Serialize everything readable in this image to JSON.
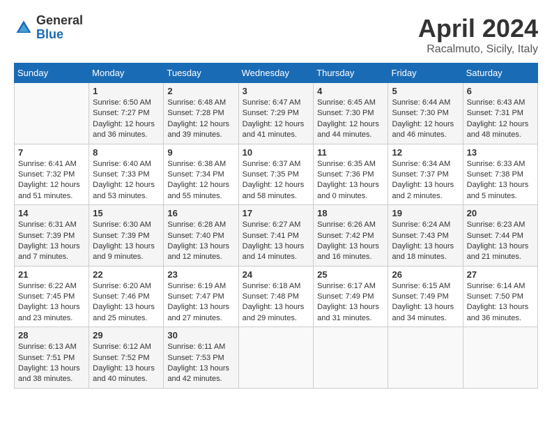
{
  "header": {
    "logo_general": "General",
    "logo_blue": "Blue",
    "title": "April 2024",
    "location": "Racalmuto, Sicily, Italy"
  },
  "days_of_week": [
    "Sunday",
    "Monday",
    "Tuesday",
    "Wednesday",
    "Thursday",
    "Friday",
    "Saturday"
  ],
  "weeks": [
    [
      {
        "day": "",
        "sunrise": "",
        "sunset": "",
        "daylight": ""
      },
      {
        "day": "1",
        "sunrise": "Sunrise: 6:50 AM",
        "sunset": "Sunset: 7:27 PM",
        "daylight": "Daylight: 12 hours and 36 minutes."
      },
      {
        "day": "2",
        "sunrise": "Sunrise: 6:48 AM",
        "sunset": "Sunset: 7:28 PM",
        "daylight": "Daylight: 12 hours and 39 minutes."
      },
      {
        "day": "3",
        "sunrise": "Sunrise: 6:47 AM",
        "sunset": "Sunset: 7:29 PM",
        "daylight": "Daylight: 12 hours and 41 minutes."
      },
      {
        "day": "4",
        "sunrise": "Sunrise: 6:45 AM",
        "sunset": "Sunset: 7:30 PM",
        "daylight": "Daylight: 12 hours and 44 minutes."
      },
      {
        "day": "5",
        "sunrise": "Sunrise: 6:44 AM",
        "sunset": "Sunset: 7:30 PM",
        "daylight": "Daylight: 12 hours and 46 minutes."
      },
      {
        "day": "6",
        "sunrise": "Sunrise: 6:43 AM",
        "sunset": "Sunset: 7:31 PM",
        "daylight": "Daylight: 12 hours and 48 minutes."
      }
    ],
    [
      {
        "day": "7",
        "sunrise": "Sunrise: 6:41 AM",
        "sunset": "Sunset: 7:32 PM",
        "daylight": "Daylight: 12 hours and 51 minutes."
      },
      {
        "day": "8",
        "sunrise": "Sunrise: 6:40 AM",
        "sunset": "Sunset: 7:33 PM",
        "daylight": "Daylight: 12 hours and 53 minutes."
      },
      {
        "day": "9",
        "sunrise": "Sunrise: 6:38 AM",
        "sunset": "Sunset: 7:34 PM",
        "daylight": "Daylight: 12 hours and 55 minutes."
      },
      {
        "day": "10",
        "sunrise": "Sunrise: 6:37 AM",
        "sunset": "Sunset: 7:35 PM",
        "daylight": "Daylight: 12 hours and 58 minutes."
      },
      {
        "day": "11",
        "sunrise": "Sunrise: 6:35 AM",
        "sunset": "Sunset: 7:36 PM",
        "daylight": "Daylight: 13 hours and 0 minutes."
      },
      {
        "day": "12",
        "sunrise": "Sunrise: 6:34 AM",
        "sunset": "Sunset: 7:37 PM",
        "daylight": "Daylight: 13 hours and 2 minutes."
      },
      {
        "day": "13",
        "sunrise": "Sunrise: 6:33 AM",
        "sunset": "Sunset: 7:38 PM",
        "daylight": "Daylight: 13 hours and 5 minutes."
      }
    ],
    [
      {
        "day": "14",
        "sunrise": "Sunrise: 6:31 AM",
        "sunset": "Sunset: 7:39 PM",
        "daylight": "Daylight: 13 hours and 7 minutes."
      },
      {
        "day": "15",
        "sunrise": "Sunrise: 6:30 AM",
        "sunset": "Sunset: 7:39 PM",
        "daylight": "Daylight: 13 hours and 9 minutes."
      },
      {
        "day": "16",
        "sunrise": "Sunrise: 6:28 AM",
        "sunset": "Sunset: 7:40 PM",
        "daylight": "Daylight: 13 hours and 12 minutes."
      },
      {
        "day": "17",
        "sunrise": "Sunrise: 6:27 AM",
        "sunset": "Sunset: 7:41 PM",
        "daylight": "Daylight: 13 hours and 14 minutes."
      },
      {
        "day": "18",
        "sunrise": "Sunrise: 6:26 AM",
        "sunset": "Sunset: 7:42 PM",
        "daylight": "Daylight: 13 hours and 16 minutes."
      },
      {
        "day": "19",
        "sunrise": "Sunrise: 6:24 AM",
        "sunset": "Sunset: 7:43 PM",
        "daylight": "Daylight: 13 hours and 18 minutes."
      },
      {
        "day": "20",
        "sunrise": "Sunrise: 6:23 AM",
        "sunset": "Sunset: 7:44 PM",
        "daylight": "Daylight: 13 hours and 21 minutes."
      }
    ],
    [
      {
        "day": "21",
        "sunrise": "Sunrise: 6:22 AM",
        "sunset": "Sunset: 7:45 PM",
        "daylight": "Daylight: 13 hours and 23 minutes."
      },
      {
        "day": "22",
        "sunrise": "Sunrise: 6:20 AM",
        "sunset": "Sunset: 7:46 PM",
        "daylight": "Daylight: 13 hours and 25 minutes."
      },
      {
        "day": "23",
        "sunrise": "Sunrise: 6:19 AM",
        "sunset": "Sunset: 7:47 PM",
        "daylight": "Daylight: 13 hours and 27 minutes."
      },
      {
        "day": "24",
        "sunrise": "Sunrise: 6:18 AM",
        "sunset": "Sunset: 7:48 PM",
        "daylight": "Daylight: 13 hours and 29 minutes."
      },
      {
        "day": "25",
        "sunrise": "Sunrise: 6:17 AM",
        "sunset": "Sunset: 7:49 PM",
        "daylight": "Daylight: 13 hours and 31 minutes."
      },
      {
        "day": "26",
        "sunrise": "Sunrise: 6:15 AM",
        "sunset": "Sunset: 7:49 PM",
        "daylight": "Daylight: 13 hours and 34 minutes."
      },
      {
        "day": "27",
        "sunrise": "Sunrise: 6:14 AM",
        "sunset": "Sunset: 7:50 PM",
        "daylight": "Daylight: 13 hours and 36 minutes."
      }
    ],
    [
      {
        "day": "28",
        "sunrise": "Sunrise: 6:13 AM",
        "sunset": "Sunset: 7:51 PM",
        "daylight": "Daylight: 13 hours and 38 minutes."
      },
      {
        "day": "29",
        "sunrise": "Sunrise: 6:12 AM",
        "sunset": "Sunset: 7:52 PM",
        "daylight": "Daylight: 13 hours and 40 minutes."
      },
      {
        "day": "30",
        "sunrise": "Sunrise: 6:11 AM",
        "sunset": "Sunset: 7:53 PM",
        "daylight": "Daylight: 13 hours and 42 minutes."
      },
      {
        "day": "",
        "sunrise": "",
        "sunset": "",
        "daylight": ""
      },
      {
        "day": "",
        "sunrise": "",
        "sunset": "",
        "daylight": ""
      },
      {
        "day": "",
        "sunrise": "",
        "sunset": "",
        "daylight": ""
      },
      {
        "day": "",
        "sunrise": "",
        "sunset": "",
        "daylight": ""
      }
    ]
  ]
}
